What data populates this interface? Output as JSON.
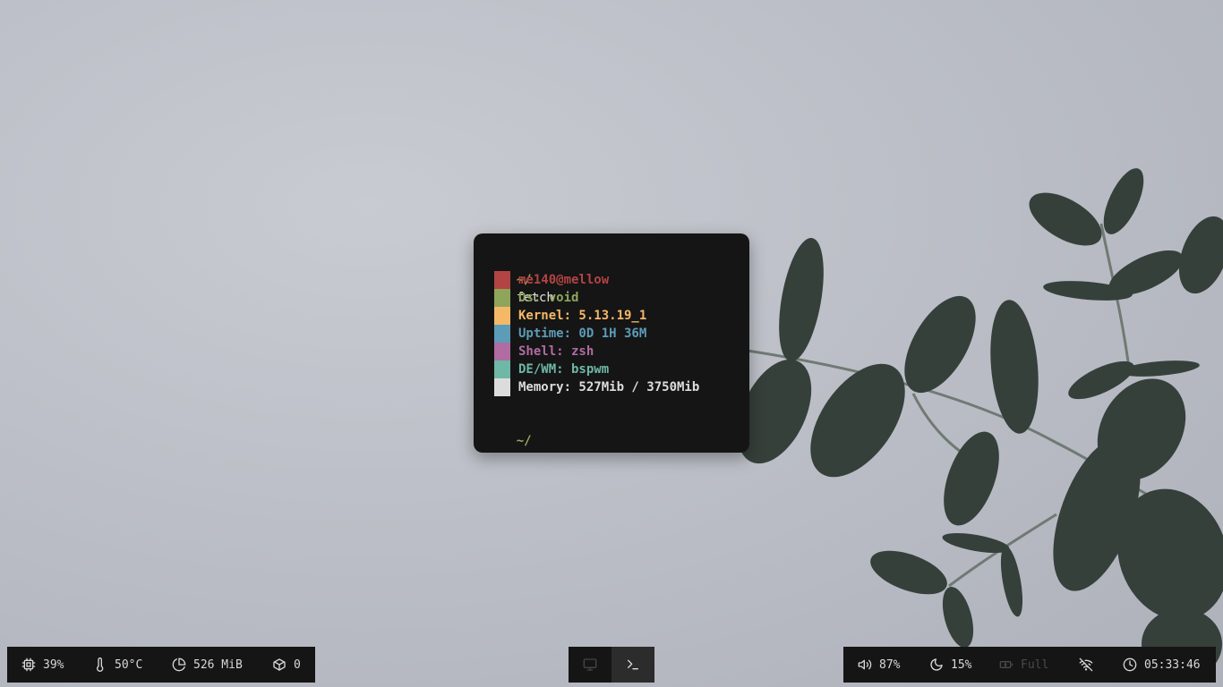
{
  "terminal": {
    "prompt": "~/",
    "command": "fetch",
    "info": [
      {
        "text": "me140@mellow",
        "color": "#b34444"
      },
      {
        "text": "Os: void",
        "color": "#8fa55a"
      },
      {
        "text": "Kernel: 5.13.19_1",
        "color": "#f5b867"
      },
      {
        "text": "Uptime: 0D 1H 36M",
        "color": "#5d9cb8"
      },
      {
        "text": "Shell: zsh",
        "color": "#b06ca3"
      },
      {
        "text": "DE/WM: bspwm",
        "color": "#6fb7a6"
      },
      {
        "text": "Memory: 527Mib / 3750Mib",
        "color": "#dcdcdc"
      }
    ],
    "end_prompt": "~/"
  },
  "left_bar": {
    "cpu": {
      "icon": "cpu-icon",
      "value": "39%"
    },
    "temp": {
      "icon": "thermometer-icon",
      "value": "50°C"
    },
    "memory": {
      "icon": "pie-chart-icon",
      "value": "526 MiB"
    },
    "packages": {
      "icon": "package-icon",
      "value": "0"
    }
  },
  "center_bar": {
    "workspaces": [
      {
        "icon": "monitor-icon",
        "active": false
      },
      {
        "icon": "terminal-icon",
        "active": true
      }
    ]
  },
  "right_bar": {
    "volume": {
      "icon": "volume-icon",
      "value": "87%"
    },
    "brightness": {
      "icon": "moon-icon",
      "value": "15%"
    },
    "battery": {
      "icon": "battery-charging-icon",
      "value": "Full"
    },
    "network": {
      "icon": "wifi-off-icon"
    },
    "clock": {
      "icon": "clock-icon",
      "value": "05:33:46"
    }
  },
  "colors": {
    "bar_bg": "#151515",
    "active_workspace": "#2c2c2c",
    "prompt": "#9aac5a"
  }
}
